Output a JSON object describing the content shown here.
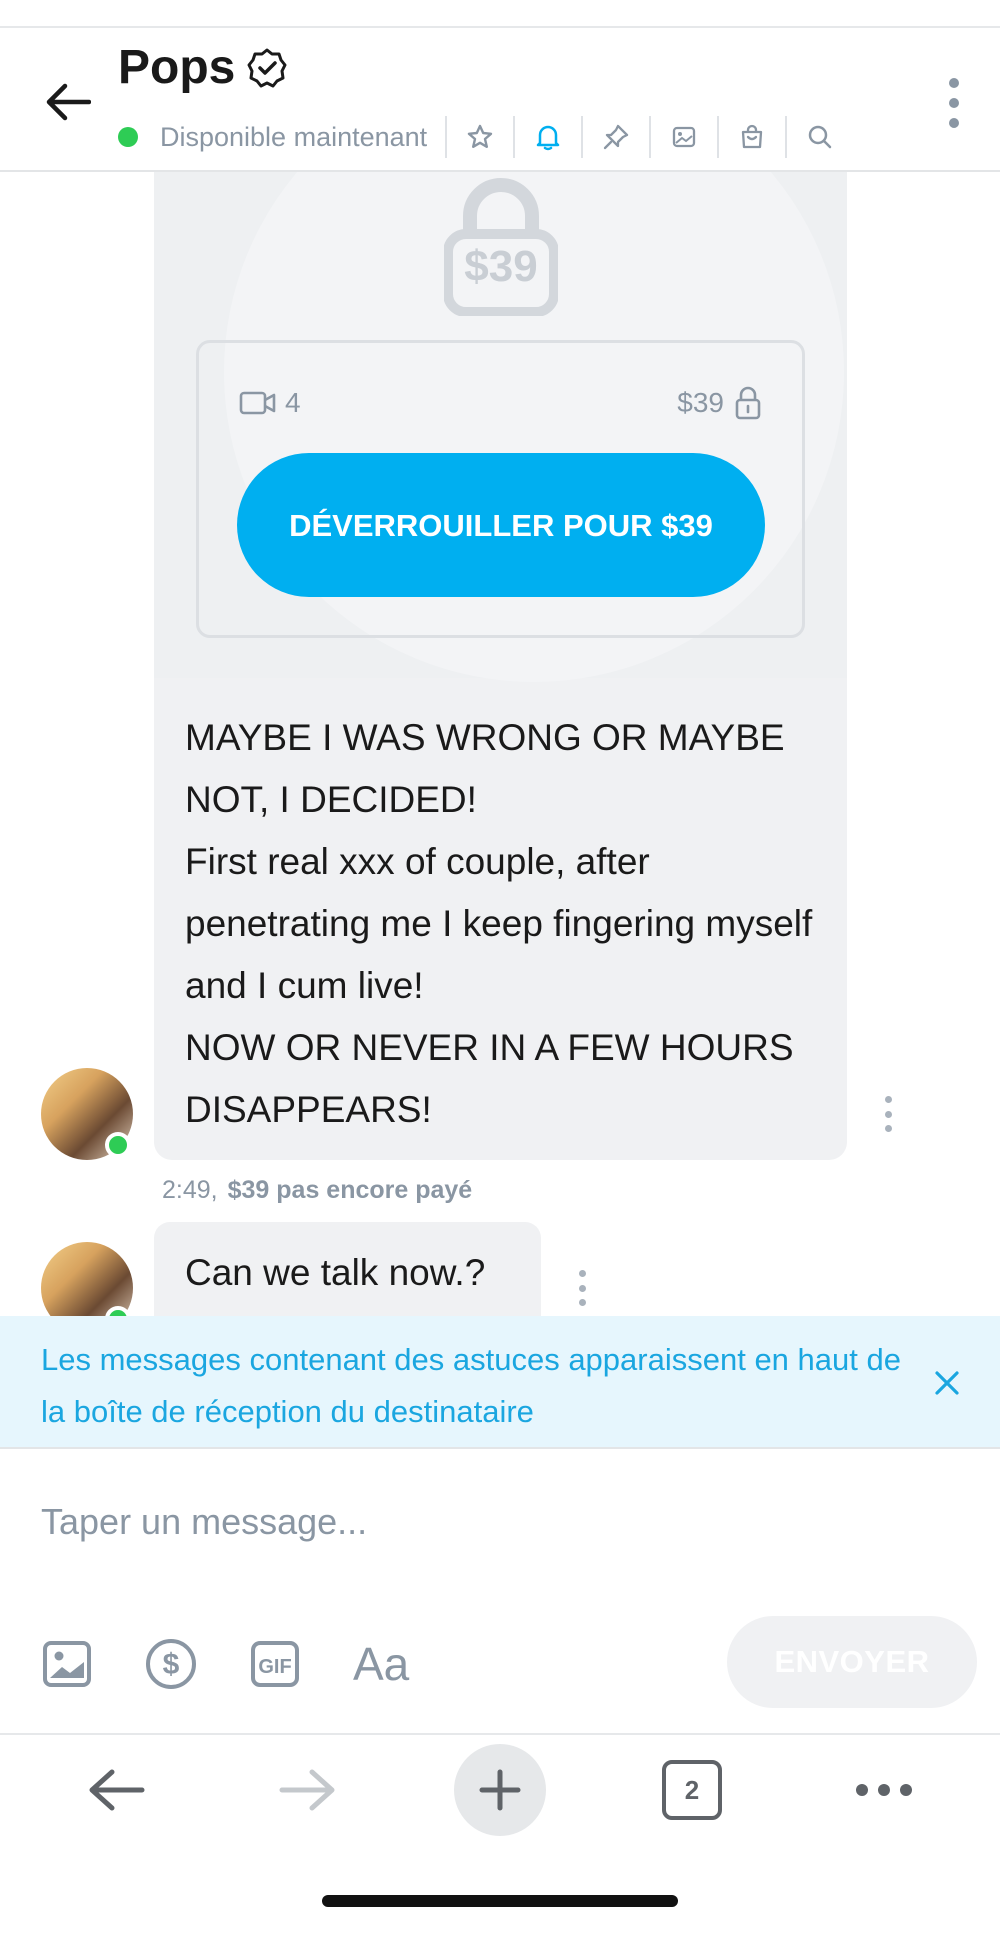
{
  "header": {
    "title": "Pops",
    "status": "Disponible maintenant",
    "icons": [
      "star-icon",
      "bell-icon",
      "pin-icon",
      "image-icon",
      "shopping-bag-icon",
      "search-icon"
    ]
  },
  "locked_post": {
    "big_price": "$39",
    "media_count": "4",
    "price": "$39",
    "unlock_label": "DÉVERROUILLER POUR $39",
    "message": "MAYBE I WAS WRONG OR MAYBE NOT, I DECIDED!\nFirst real xxx of couple, after penetrating me I keep fingering myself and I cum live!\nNOW OR NEVER IN A FEW HOURS DISAPPEARS!",
    "time": "2:49,",
    "payment_status": "$39 pas encore payé"
  },
  "second_message": {
    "text": "Can we talk now.?"
  },
  "tip_banner": {
    "text": "Les messages contenant des astuces apparaissent en haut de la boîte de réception du destinataire"
  },
  "composer": {
    "placeholder": "Taper un message...",
    "text_format_label": "Aa",
    "send_label": "ENVOYER"
  },
  "browser": {
    "tab_count": "2"
  },
  "colors": {
    "accent": "#00aff0",
    "online": "#2ecc55",
    "muted": "#8a96a3",
    "banner_bg": "#e6f6fd"
  }
}
